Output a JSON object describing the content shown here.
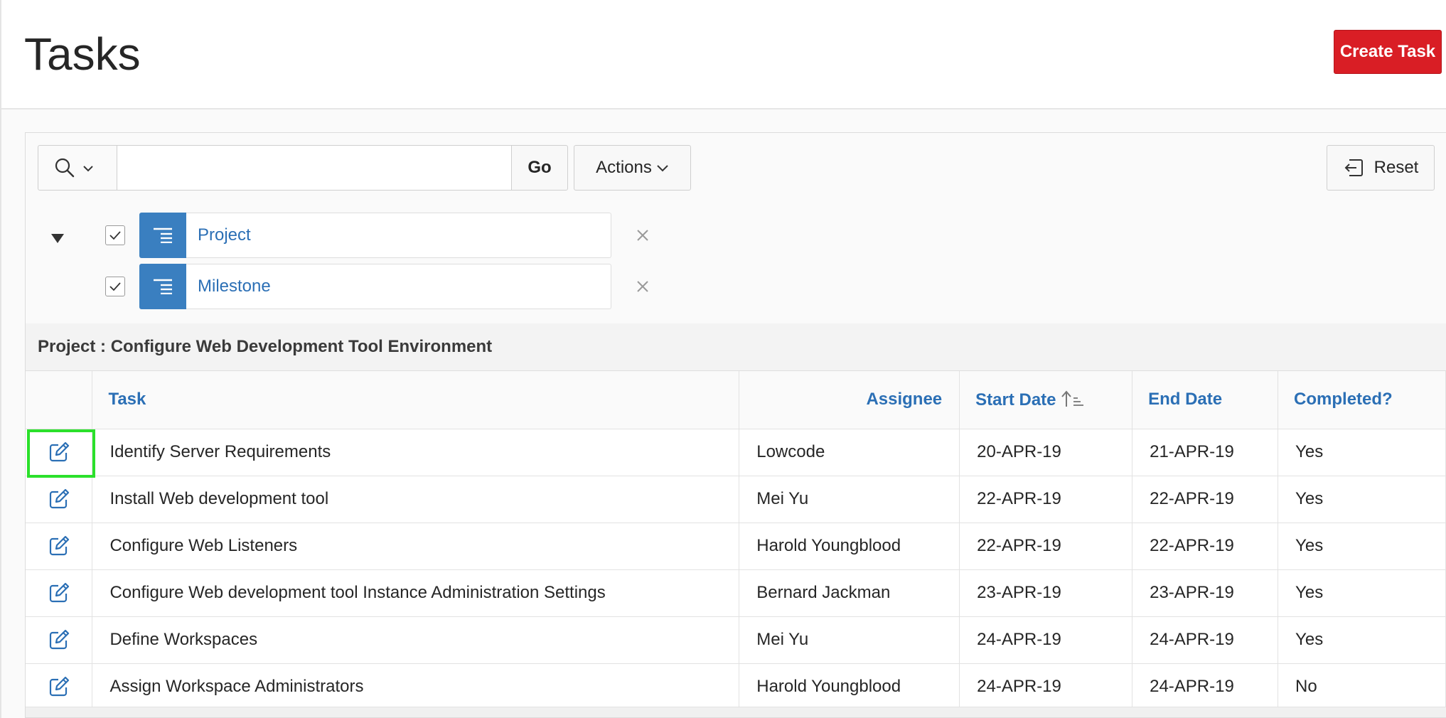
{
  "page": {
    "title": "Tasks",
    "create_button_label": "Create Task"
  },
  "toolbar": {
    "search_value": "",
    "go_label": "Go",
    "actions_label": "Actions",
    "reset_label": "Reset",
    "search_icon": "search-icon",
    "actions_icon": "chevron-down-icon",
    "reset_icon": "reset-icon"
  },
  "control_breaks": [
    {
      "label": "Project",
      "enabled": true
    },
    {
      "label": "Milestone",
      "enabled": true
    }
  ],
  "group": {
    "heading": "Project : Configure Web Development Tool Environment"
  },
  "table": {
    "columns": {
      "task": "Task",
      "assignee": "Assignee",
      "start_date": "Start Date",
      "end_date": "End Date",
      "completed": "Completed?"
    },
    "sort": {
      "column": "start_date",
      "direction": "ascending"
    },
    "rows": [
      {
        "task": "Identify Server Requirements",
        "assignee": "Lowcode",
        "start_date": "20-APR-19",
        "end_date": "21-APR-19",
        "completed": "Yes"
      },
      {
        "task": "Install Web development tool",
        "assignee": "Mei Yu",
        "start_date": "22-APR-19",
        "end_date": "22-APR-19",
        "completed": "Yes"
      },
      {
        "task": "Configure Web Listeners",
        "assignee": "Harold Youngblood",
        "start_date": "22-APR-19",
        "end_date": "22-APR-19",
        "completed": "Yes"
      },
      {
        "task": "Configure Web development tool Instance Administration Settings",
        "assignee": "Bernard Jackman",
        "start_date": "23-APR-19",
        "end_date": "23-APR-19",
        "completed": "Yes"
      },
      {
        "task": "Define Workspaces",
        "assignee": "Mei Yu",
        "start_date": "24-APR-19",
        "end_date": "24-APR-19",
        "completed": "Yes"
      },
      {
        "task": "Assign Workspace Administrators",
        "assignee": "Harold Youngblood",
        "start_date": "24-APR-19",
        "end_date": "24-APR-19",
        "completed": "No"
      }
    ]
  },
  "colors": {
    "accent": "#2b6fb5",
    "primary_button": "#d91e25",
    "break_icon": "#3a7fc0",
    "highlight": "#2be02b"
  }
}
